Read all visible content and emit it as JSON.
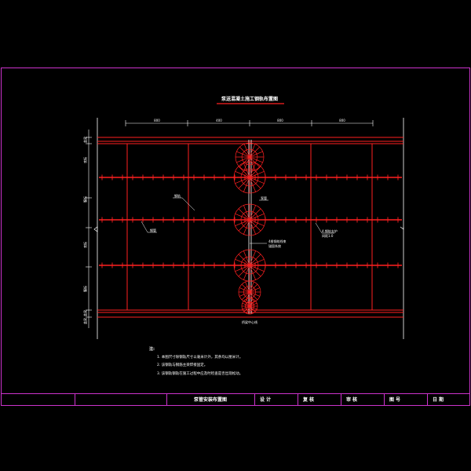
{
  "drawing": {
    "title": "泵送混凝土施工钢轨布置图",
    "dimensions": [
      "800",
      "400",
      "800",
      "800"
    ],
    "row_labels": [
      "盖梁",
      "底板",
      "腹板",
      "底板",
      "腹板",
      "盖梁",
      "盖梁"
    ],
    "callouts": {
      "c1": "钢轨",
      "c2": "泵管",
      "c3": "钢管",
      "c4": "4根钢绞线束",
      "c4b": "锚固系统",
      "c5": "4.钢轨支护",
      "c5b": "间距1.0"
    },
    "bottom_label": "桥梁中心线",
    "notes": {
      "heading": "注:",
      "items": [
        "1. 本图尺寸除钢轨尺寸以毫米计外，其余均以厘米计。",
        "2. 该钢轨与钢筋主梁焊接固定。",
        "3. 该钢轨钢轨在施工过程中应及时检查是否出现松动。"
      ]
    }
  },
  "title_block": {
    "drawing_name": "泵管安装布置图",
    "design": "设 计",
    "review": "复 核",
    "approve": "审 核",
    "drawing_no": "图 号",
    "date": "日 期"
  },
  "colors": {
    "frame": "#cc33cc",
    "red": "#ff2020",
    "white": "#ffffff",
    "background": "#000000"
  }
}
